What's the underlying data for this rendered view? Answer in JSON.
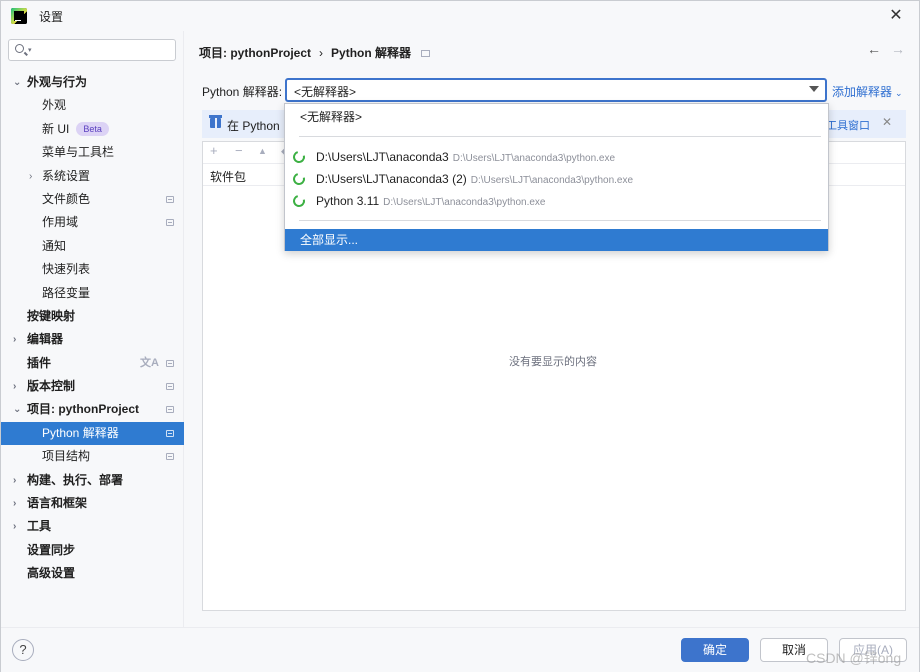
{
  "window": {
    "title": "设置",
    "close_glyph": "✕"
  },
  "sidebar": {
    "search_placeholder": "",
    "items": [
      {
        "label": "外观与行为",
        "chevron": "⌄",
        "bold": true
      },
      {
        "label": "外观"
      },
      {
        "label": "新 UI",
        "badge": "Beta"
      },
      {
        "label": "菜单与工具栏"
      },
      {
        "label": "系统设置",
        "chevron": "›"
      },
      {
        "label": "文件颜色"
      },
      {
        "label": "作用域"
      },
      {
        "label": "通知"
      },
      {
        "label": "快速列表"
      },
      {
        "label": "路径变量"
      },
      {
        "label": "按键映射",
        "bold": true
      },
      {
        "label": "编辑器",
        "chevron": "›",
        "bold": true
      },
      {
        "label": "插件",
        "bold": true
      },
      {
        "label": "版本控制",
        "chevron": "›",
        "bold": true
      },
      {
        "label": "项目: pythonProject",
        "chevron": "⌄",
        "bold": true
      },
      {
        "label": "Python 解释器",
        "selected": true
      },
      {
        "label": "项目结构"
      },
      {
        "label": "构建、执行、部署",
        "chevron": "›",
        "bold": true
      },
      {
        "label": "语言和框架",
        "chevron": "›",
        "bold": true
      },
      {
        "label": "工具",
        "chevron": "›",
        "bold": true
      },
      {
        "label": "设置同步",
        "bold": true
      },
      {
        "label": "高级设置",
        "bold": true
      }
    ]
  },
  "breadcrumb": {
    "project": "项目: pythonProject",
    "sep": "›",
    "page": "Python 解释器"
  },
  "nav": {
    "back": "←",
    "forward": "→"
  },
  "interpreter": {
    "label": "Python 解释器:",
    "value": "<无解释器>",
    "add_label": "添加解释器",
    "add_caret": "⌄"
  },
  "banner": {
    "text": "在 Python",
    "link": "工具窗口",
    "close": "✕"
  },
  "package_toolbar": {
    "add": "+",
    "remove": "−",
    "up": "▲",
    "more": "◆"
  },
  "package_table": {
    "column_header": "软件包",
    "empty_text": "没有要显示的内容"
  },
  "dropdown": {
    "none_option": "<无解释器>",
    "options": [
      {
        "name": "D:\\Users\\LJT\\anaconda3",
        "path": "D:\\Users\\LJT\\anaconda3\\python.exe"
      },
      {
        "name": "D:\\Users\\LJT\\anaconda3 (2)",
        "path": "D:\\Users\\LJT\\anaconda3\\python.exe"
      },
      {
        "name": "Python 3.11",
        "path": "D:\\Users\\LJT\\anaconda3\\python.exe"
      }
    ],
    "show_all": "全部显示..."
  },
  "footer": {
    "help": "?",
    "ok": "确定",
    "cancel": "取消",
    "apply": "应用(A)"
  },
  "watermark": "CSDN @锌ong",
  "colors": {
    "accent": "#2f7bd1",
    "link": "#2f6fd1",
    "selected_bg": "#2f7bd1",
    "python_icon": "#3cb043"
  }
}
